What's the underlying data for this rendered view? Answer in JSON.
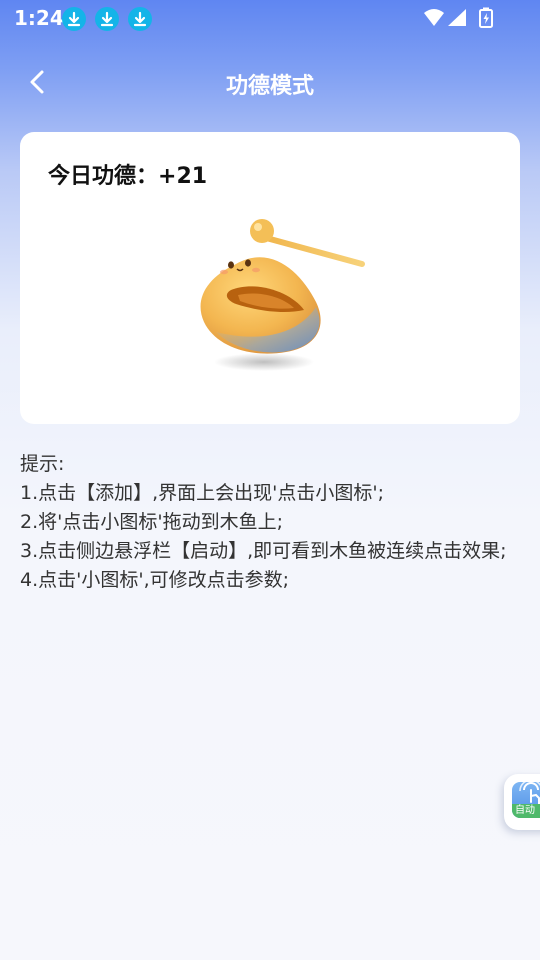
{
  "status_bar": {
    "time": "1:24",
    "download_icons": [
      "download-notification-icon",
      "download-notification-icon",
      "download-notification-icon"
    ],
    "right_icons": [
      "wifi-icon",
      "cellular-signal-icon",
      "battery-charging-icon"
    ]
  },
  "app_bar": {
    "back_icon": "chevron-left-icon",
    "title": "功德模式"
  },
  "merit_card": {
    "label": "今日功德：",
    "value": "+21",
    "image": "wooden-fish-with-mallet"
  },
  "tips": {
    "heading": "提示:",
    "lines": [
      "1.点击【添加】,界面上会出现'点击小图标';",
      "2.将'点击小图标'拖动到木鱼上;",
      "3.点击侧边悬浮栏【启动】,即可看到木鱼被连续点击效果;",
      "4.点击'小图标',可修改点击参数;"
    ]
  },
  "floating_button": {
    "icon": "touch-click-icon",
    "label": "自动"
  },
  "colors": {
    "accent": "#5f86f2",
    "download_badge": "#14b4e8",
    "float_label": "#4fb96a"
  }
}
